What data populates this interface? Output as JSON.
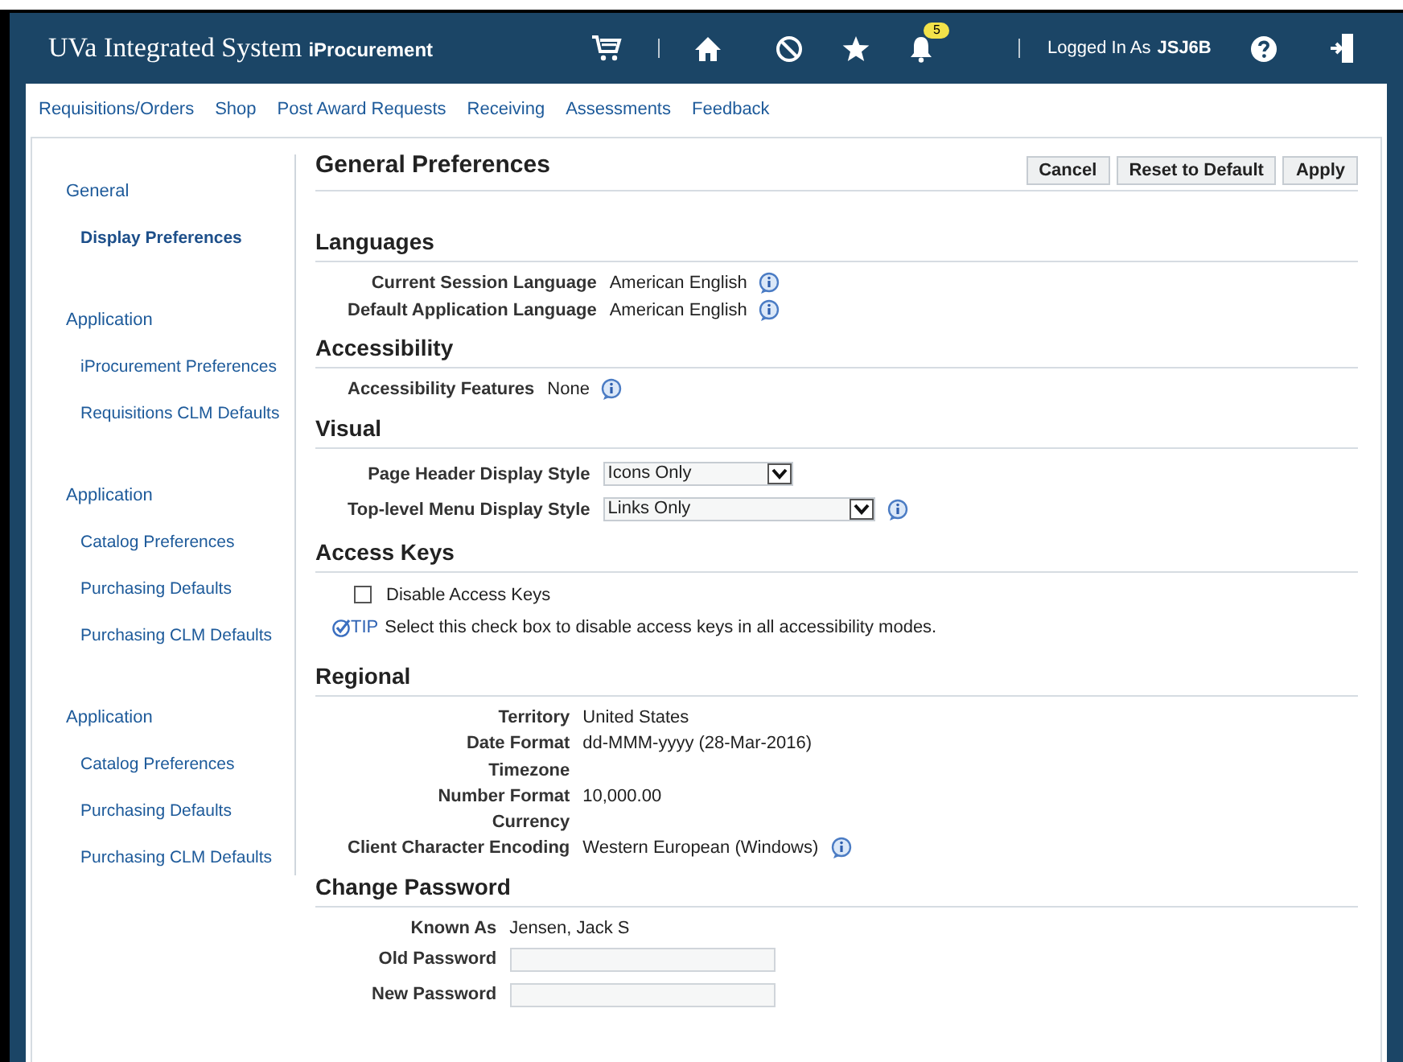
{
  "header": {
    "app_title": "UVa Integrated System",
    "module": "iProcurement",
    "notification_count": "5",
    "logged_in_label": "Logged In As",
    "user": "JSJ6B"
  },
  "nav": [
    "Requisitions/Orders",
    "Shop",
    "Post Award Requests",
    "Receiving",
    "Assessments",
    "Feedback"
  ],
  "sidebar": [
    {
      "heading": "General",
      "items": [
        {
          "label": "Display Preferences",
          "selected": true
        }
      ]
    },
    {
      "heading": "Application",
      "items": [
        {
          "label": "iProcurement Preferences",
          "selected": false
        },
        {
          "label": "Requisitions CLM Defaults",
          "selected": false
        }
      ]
    },
    {
      "heading": "Application",
      "items": [
        {
          "label": "Catalog Preferences",
          "selected": false
        },
        {
          "label": "Purchasing Defaults",
          "selected": false
        },
        {
          "label": "Purchasing CLM Defaults",
          "selected": false
        }
      ]
    },
    {
      "heading": "Application",
      "items": [
        {
          "label": "Catalog Preferences",
          "selected": false
        },
        {
          "label": "Purchasing Defaults",
          "selected": false
        },
        {
          "label": "Purchasing CLM Defaults",
          "selected": false
        }
      ]
    }
  ],
  "page": {
    "title": "General Preferences",
    "buttons": [
      "Cancel",
      "Reset to Default",
      "Apply"
    ]
  },
  "sections": [
    {
      "title": "Languages",
      "rows": [
        {
          "kind": "text",
          "label": "Current Session Language",
          "value": "American English",
          "info": true
        },
        {
          "kind": "text",
          "label": "Default Application Language",
          "value": "American English",
          "info": true
        }
      ]
    },
    {
      "title": "Accessibility",
      "rows": [
        {
          "kind": "text",
          "label": "Accessibility Features",
          "value": "None",
          "info": true
        }
      ]
    },
    {
      "title": "Visual",
      "rows": [
        {
          "kind": "select",
          "label": "Page Header Display Style",
          "value": "Icons Only",
          "wide": false,
          "info": false
        },
        {
          "kind": "select",
          "label": "Top-level Menu Display Style",
          "value": "Links Only",
          "wide": true,
          "info": true
        }
      ]
    },
    {
      "title": "Access Keys",
      "rows": [
        {
          "kind": "checkbox",
          "label": "Disable Access Keys",
          "checked": false
        },
        {
          "kind": "tip",
          "tag": "TIP",
          "text": "Select this check box to disable access keys in all accessibility modes."
        }
      ]
    },
    {
      "title": "Regional",
      "rows": [
        {
          "kind": "text",
          "label": "Territory",
          "value": "United States",
          "info": false
        },
        {
          "kind": "text",
          "label": "Date Format",
          "value": "dd-MMM-yyyy (28-Mar-2016)",
          "info": false
        },
        {
          "kind": "text",
          "label": "Timezone",
          "info": false
        },
        {
          "kind": "text",
          "label": "Number Format",
          "value": "10,000.00",
          "info": false
        },
        {
          "kind": "text",
          "label": "Currency",
          "info": false
        },
        {
          "kind": "text",
          "label": "Client Character Encoding",
          "value": "Western European (Windows)",
          "info": true
        }
      ]
    },
    {
      "title": "Change Password",
      "rows": [
        {
          "kind": "text",
          "label": "Known As",
          "value": "Jensen, Jack S",
          "info": false
        },
        {
          "kind": "password",
          "label": "Old Password"
        },
        {
          "kind": "password",
          "label": "New Password"
        }
      ]
    }
  ]
}
